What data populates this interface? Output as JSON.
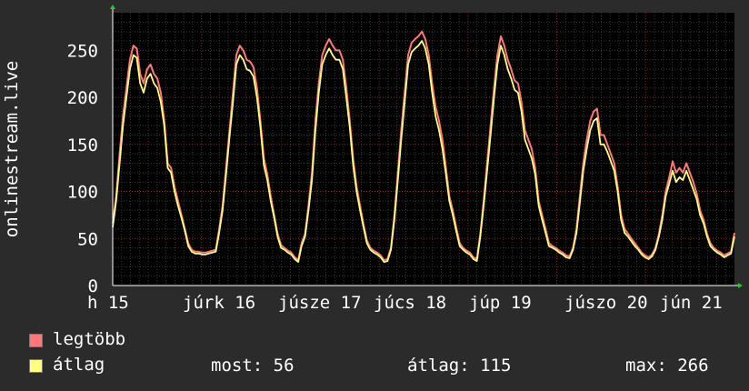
{
  "chart_data": {
    "type": "line",
    "ylabel": "onlinestream.live",
    "ylim": [
      0,
      290
    ],
    "yticks": [
      0,
      50,
      100,
      150,
      200,
      250
    ],
    "x_tick_labels": [
      "h 15",
      "júrk 16",
      "júsze 17",
      "júcs 18",
      "júp 19",
      "júszo 20",
      "jún 21",
      "jún"
    ],
    "series": [
      {
        "name": "legtöbb",
        "color": "#ff7777",
        "values": [
          66,
          95,
          140,
          180,
          210,
          240,
          255,
          252,
          225,
          215,
          230,
          235,
          225,
          220,
          205,
          175,
          130,
          125,
          105,
          90,
          75,
          60,
          45,
          38,
          36,
          36,
          35,
          35,
          36,
          37,
          38,
          60,
          85,
          125,
          165,
          205,
          245,
          255,
          250,
          240,
          238,
          232,
          210,
          175,
          135,
          118,
          95,
          75,
          55,
          43,
          40,
          37,
          35,
          30,
          27,
          45,
          55,
          85,
          120,
          175,
          215,
          245,
          255,
          262,
          255,
          250,
          250,
          240,
          210,
          175,
          135,
          105,
          85,
          65,
          48,
          40,
          37,
          35,
          32,
          27,
          28,
          40,
          75,
          120,
          165,
          205,
          245,
          258,
          262,
          265,
          270,
          262,
          245,
          215,
          190,
          175,
          155,
          125,
          95,
          80,
          62,
          45,
          40,
          37,
          35,
          30,
          28,
          55,
          90,
          130,
          170,
          210,
          245,
          265,
          255,
          240,
          230,
          218,
          215,
          195,
          165,
          155,
          145,
          125,
          90,
          75,
          60,
          45,
          42,
          40,
          37,
          35,
          32,
          31,
          40,
          60,
          95,
          130,
          155,
          175,
          185,
          188,
          160,
          160,
          150,
          140,
          130,
          105,
          75,
          60,
          55,
          50,
          45,
          40,
          35,
          32,
          30,
          33,
          40,
          55,
          75,
          100,
          115,
          132,
          120,
          125,
          120,
          130,
          120,
          110,
          98,
          80,
          70,
          55,
          45,
          40,
          37,
          35,
          32,
          34,
          36,
          56
        ]
      },
      {
        "name": "átlag",
        "color": "#ffff80",
        "values": [
          62,
          90,
          130,
          170,
          200,
          230,
          245,
          242,
          215,
          205,
          220,
          225,
          215,
          210,
          195,
          170,
          125,
          120,
          100,
          85,
          72,
          58,
          42,
          36,
          34,
          34,
          33,
          33,
          34,
          35,
          36,
          56,
          80,
          118,
          158,
          195,
          235,
          245,
          240,
          230,
          228,
          222,
          200,
          168,
          128,
          112,
          90,
          72,
          52,
          40,
          38,
          35,
          33,
          28,
          25,
          42,
          52,
          80,
          112,
          165,
          205,
          235,
          245,
          252,
          245,
          240,
          240,
          230,
          200,
          168,
          128,
          100,
          80,
          62,
          45,
          38,
          35,
          33,
          30,
          25,
          26,
          38,
          70,
          112,
          155,
          195,
          235,
          248,
          252,
          255,
          260,
          252,
          235,
          205,
          180,
          165,
          145,
          118,
          90,
          75,
          58,
          42,
          38,
          35,
          33,
          28,
          26,
          52,
          85,
          122,
          160,
          200,
          235,
          255,
          245,
          230,
          220,
          208,
          205,
          185,
          155,
          145,
          135,
          118,
          85,
          70,
          56,
          42,
          40,
          38,
          35,
          33,
          30,
          29,
          38,
          56,
          88,
          122,
          145,
          165,
          175,
          178,
          150,
          150,
          142,
          132,
          122,
          100,
          70,
          56,
          52,
          47,
          42,
          38,
          33,
          30,
          28,
          31,
          38,
          52,
          70,
          95,
          108,
          122,
          110,
          115,
          112,
          122,
          112,
          102,
          92,
          75,
          66,
          52,
          42,
          38,
          35,
          33,
          30,
          32,
          34,
          52
        ]
      }
    ],
    "legend_position": "bottom-left",
    "grid": true
  },
  "legend": {
    "max_label": "legtöbb",
    "avg_label": "átlag",
    "now_text": "most: 56",
    "average_text": "átlag: 115",
    "max_text": "max: 266"
  }
}
